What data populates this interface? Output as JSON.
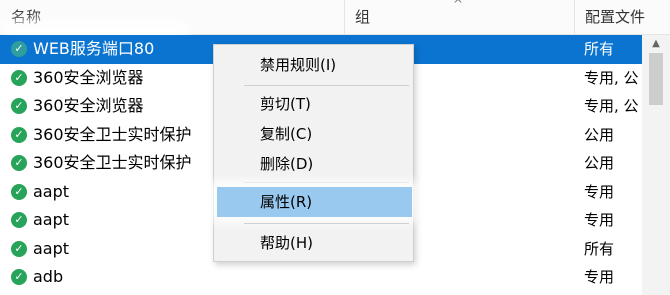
{
  "columns": {
    "name": "名称",
    "group": "组",
    "profile": "配置文件",
    "sort_arrow": "^"
  },
  "icons": {
    "check": "green-check-shield-icon"
  },
  "rows": [
    {
      "name": "WEB服务端口80",
      "profile": "所有",
      "selected": true
    },
    {
      "name": "360安全浏览器",
      "profile": "专用, 公"
    },
    {
      "name": "360安全浏览器",
      "profile": "专用, 公"
    },
    {
      "name": "360安全卫士实时保护",
      "profile": "公用"
    },
    {
      "name": "360安全卫士实时保护",
      "profile": "公用"
    },
    {
      "name": "aapt",
      "profile": "专用"
    },
    {
      "name": "aapt",
      "profile": "专用"
    },
    {
      "name": "aapt",
      "profile": "所有"
    },
    {
      "name": "adb",
      "profile": "专用"
    }
  ],
  "context_menu": {
    "disable_rule": "禁用规则(I)",
    "cut": "剪切(T)",
    "copy": "复制(C)",
    "delete": "删除(D)",
    "properties": "属性(R)",
    "help": "帮助(H)"
  },
  "colors": {
    "selection": "#0a74d0",
    "menu_highlight": "#99c9ef",
    "check_green": "#27a35a"
  }
}
